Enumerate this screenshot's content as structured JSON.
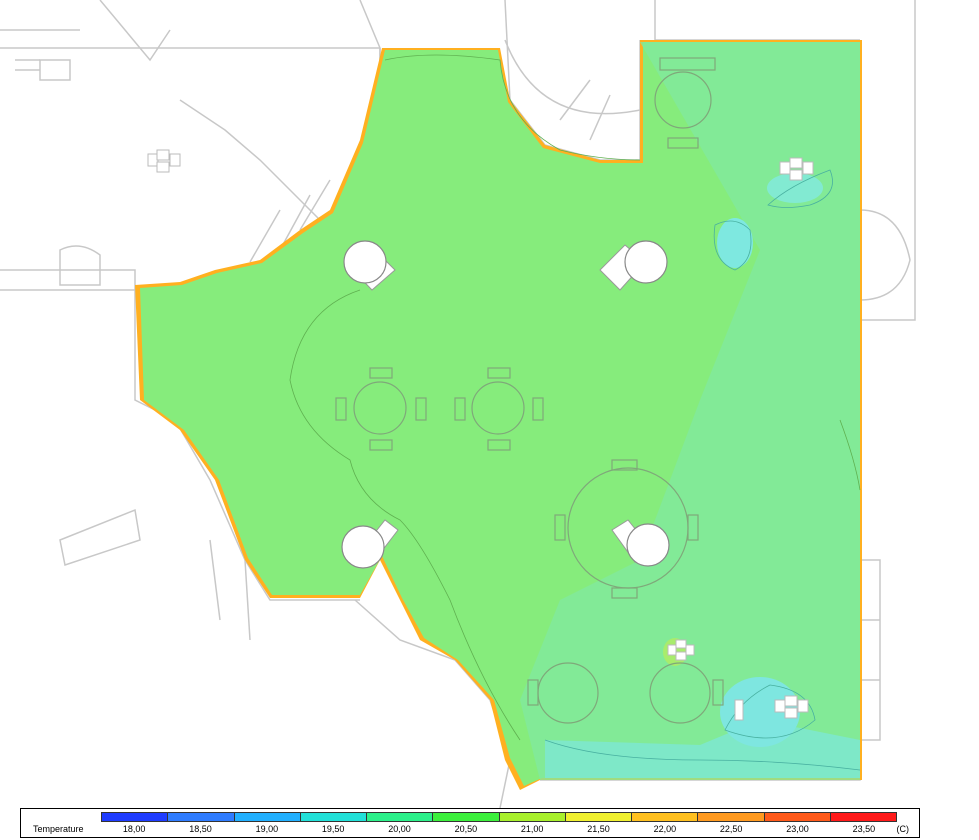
{
  "legend": {
    "title": "Temperature",
    "unit": "(C)",
    "ticks": [
      "18,00",
      "18,50",
      "19,00",
      "19,50",
      "20,00",
      "20,50",
      "21,00",
      "21,50",
      "22,00",
      "22,50",
      "23,00",
      "23,50"
    ],
    "colors": [
      "#1f3cff",
      "#2f7cff",
      "#22b0ff",
      "#22e0d8",
      "#2cf08a",
      "#3cf03c",
      "#a8f02c",
      "#f0f030",
      "#ffc020",
      "#ff9a20",
      "#ff5a1a",
      "#ff1a1a"
    ]
  },
  "scene": {
    "floor_colors": {
      "main": "#86ec7c",
      "cool": "#7fe8a8",
      "cold": "#7ee8e0",
      "hot_edge": "#ffb020"
    }
  }
}
